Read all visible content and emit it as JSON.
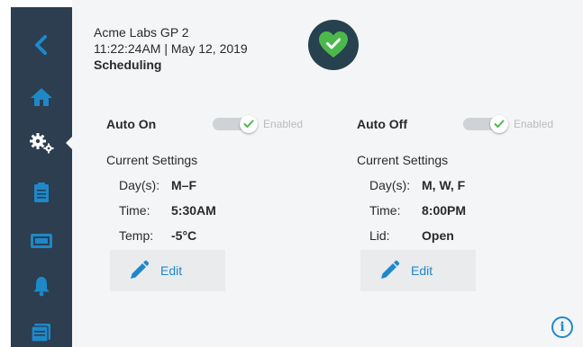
{
  "header": {
    "device_name": "Acme Labs GP 2",
    "datetime": "11:22:24AM | May 12, 2019",
    "page_title": "Scheduling",
    "status_icon": "heart-check-icon"
  },
  "colors": {
    "sidebar": "#2c3e50",
    "accent": "#1e88c9",
    "background": "#f4f5f6",
    "status_badge": "#27414f",
    "status_heart": "#4cb84c"
  },
  "sidebar": {
    "items": [
      {
        "icon": "back-chevron-icon"
      },
      {
        "icon": "home-icon"
      },
      {
        "icon": "settings-gears-icon",
        "active": true
      },
      {
        "icon": "clipboard-icon"
      },
      {
        "icon": "monitor-icon"
      },
      {
        "icon": "bell-icon"
      },
      {
        "icon": "folder-list-icon"
      }
    ]
  },
  "auto_on": {
    "label": "Auto On",
    "toggle_text": "Enabled",
    "enabled": true,
    "settings_heading": "Current Settings",
    "rows": [
      {
        "key": "Day(s):",
        "value": "M–F"
      },
      {
        "key": "Time:",
        "value": "5:30AM"
      },
      {
        "key": "Temp:",
        "value": "-5°C"
      }
    ],
    "edit_label": "Edit"
  },
  "auto_off": {
    "label": "Auto Off",
    "toggle_text": "Enabled",
    "enabled": true,
    "settings_heading": "Current Settings",
    "rows": [
      {
        "key": "Day(s):",
        "value": "M, W, F"
      },
      {
        "key": "Time:",
        "value": "8:00PM"
      },
      {
        "key": "Lid:",
        "value": "Open"
      }
    ],
    "edit_label": "Edit"
  },
  "footer": {
    "info_glyph": "i"
  }
}
